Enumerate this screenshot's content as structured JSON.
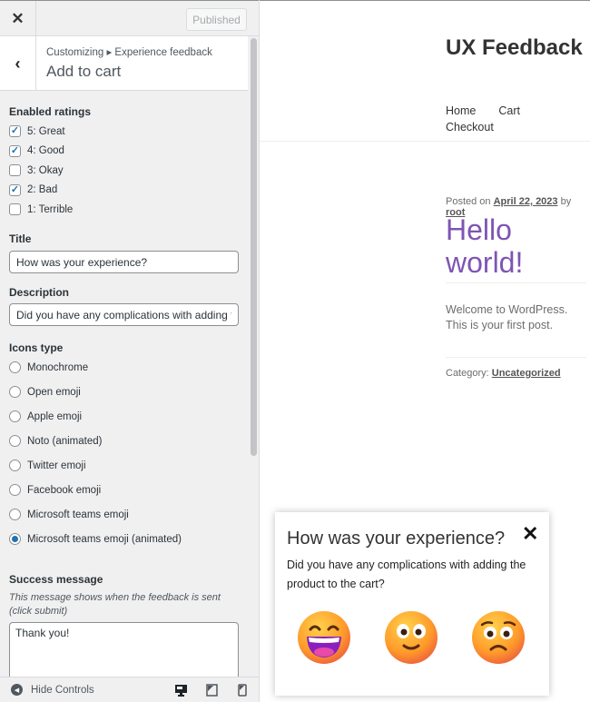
{
  "header": {
    "close_label": "✕",
    "published_label": "Published"
  },
  "section": {
    "breadcrumb": "Customizing ▸ Experience feedback",
    "title": "Add to cart",
    "back_label": "‹"
  },
  "ratings": {
    "label": "Enabled ratings",
    "items": [
      {
        "label": "5: Great",
        "checked": true
      },
      {
        "label": "4: Good",
        "checked": true
      },
      {
        "label": "3: Okay",
        "checked": false
      },
      {
        "label": "2: Bad",
        "checked": true
      },
      {
        "label": "1: Terrible",
        "checked": false
      }
    ]
  },
  "title_field": {
    "label": "Title",
    "value": "How was your experience?"
  },
  "description_field": {
    "label": "Description",
    "value": "Did you have any complications with adding the product to the cart?"
  },
  "icons_type": {
    "label": "Icons type",
    "options": [
      "Monochrome",
      "Open emoji",
      "Apple emoji",
      "Noto (animated)",
      "Twitter emoji",
      "Facebook emoji",
      "Microsoft teams emoji",
      "Microsoft teams emoji (animated)"
    ],
    "selected": "Microsoft teams emoji (animated)"
  },
  "success": {
    "label": "Success message",
    "hint": "This message shows when the feedback is sent (click submit)",
    "value": "Thank you!"
  },
  "footer": {
    "hide_label": "Hide Controls"
  },
  "site": {
    "title": "UX Feedback",
    "nav": [
      "Home",
      "Cart",
      "Checkout"
    ],
    "posted_prefix": "Posted on",
    "date": "April 22, 2023",
    "by": "by",
    "author": "root",
    "post_title": "Hello world!",
    "excerpt": "Welcome to WordPress. This is your first post.",
    "category_prefix": "Category:",
    "category": "Uncategorized"
  },
  "popup": {
    "title": "How was your experience?",
    "description": "Did you have any complications with adding the product to the cart?",
    "close_label": "✕",
    "emojis": [
      "great",
      "good",
      "bad"
    ]
  },
  "colors": {
    "accent": "#2271b1",
    "post_title": "#7f54b3"
  }
}
